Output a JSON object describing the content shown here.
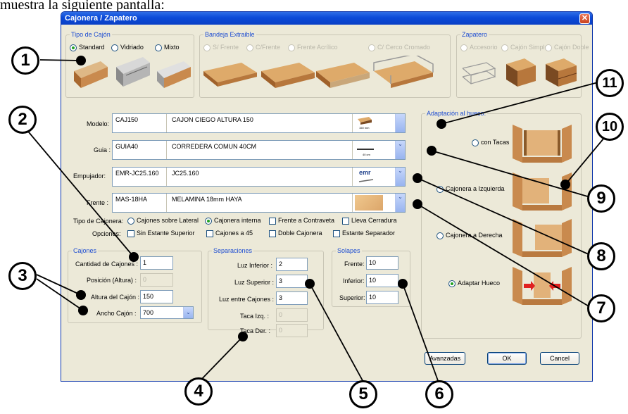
{
  "heading": "muestra la siguiente pantalla:",
  "window": {
    "title": "Cajonera / Zapatero",
    "close_glyph": "✕"
  },
  "tipo_cajon": {
    "legend": "Tipo de Cajón",
    "options": [
      {
        "label": "Standard",
        "selected": true
      },
      {
        "label": "Vidriado",
        "selected": false
      },
      {
        "label": "Mixto",
        "selected": false
      }
    ]
  },
  "bandeja": {
    "legend": "Bandeja Extraible",
    "options": [
      {
        "label": "S/ Frente"
      },
      {
        "label": "C/Frente"
      },
      {
        "label": "Frente Acrílico"
      },
      {
        "label": "C/ Cerco Cromado"
      }
    ]
  },
  "zapatero": {
    "legend": "Zapatero",
    "options": [
      {
        "label": "Accesorio"
      },
      {
        "label": "Cajón Simple"
      },
      {
        "label": "Cajón Doble"
      }
    ]
  },
  "combos": {
    "modelo": {
      "label": "Modelo:",
      "code": "CAJ150",
      "desc": "CAJON CIEGO ALTURA 150",
      "thumb_caption": "150 mm"
    },
    "guia": {
      "label": "Guia :",
      "code": "GUIA40",
      "desc": "CORREDERA COMUN 40CM",
      "thumb_caption": "40 cm"
    },
    "empujador": {
      "label": "Empujador:",
      "code": "EMR-JC25.160",
      "desc": "JC25.160",
      "thumb_caption": "emr"
    },
    "frente": {
      "label": "Frente :",
      "code": "MAS-18HA",
      "desc": "MELAMINA 18mm HAYA"
    }
  },
  "tipo_cajonera": {
    "label": "Tipo de Cajonera:",
    "options": [
      {
        "label": "Cajones sobre Lateral",
        "selected": false
      },
      {
        "label": "Cajonera interna",
        "selected": true
      }
    ],
    "checks": [
      {
        "label": "Frente a Contraveta"
      },
      {
        "label": "Lleva Cerradura"
      }
    ]
  },
  "opciones": {
    "label": "Opciones:",
    "checks": [
      {
        "label": "Sin Estante Superior"
      },
      {
        "label": "Cajones a 45"
      },
      {
        "label": "Doble Cajonera"
      },
      {
        "label": "Estante Separador"
      }
    ]
  },
  "cajones": {
    "legend": "Cajones",
    "cantidad_label": "Cantidad de Cajones :",
    "cantidad": "1",
    "posicion_label": "Posición (Altura) :",
    "posicion": "0",
    "altura_label": "Altura del Cajón :",
    "altura": "150",
    "ancho_label": "Ancho Cajón :",
    "ancho": "700"
  },
  "separaciones": {
    "legend": "Separaciones",
    "luz_inferior_label": "Luz Inferior :",
    "luz_inferior": "2",
    "luz_superior_label": "Luz Superior :",
    "luz_superior": "3",
    "luz_entre_label": "Luz entre Cajones :",
    "luz_entre": "3",
    "taca_izq_label": "Taca Izq. :",
    "taca_izq": "0",
    "taca_der_label": "Taca Der. :",
    "taca_der": "0"
  },
  "solapes": {
    "legend": "Solapes",
    "frente_label": "Frente:",
    "frente": "10",
    "inferior_label": "Inferior:",
    "inferior": "10",
    "superior_label": "Superior:",
    "superior": "10"
  },
  "adaptacion": {
    "legend": "Adaptación al hueco:",
    "options": [
      {
        "label": "con Tacas",
        "selected": false
      },
      {
        "label": "Cajonera a Izquierda",
        "selected": false
      },
      {
        "label": "Cajonera a Derecha",
        "selected": false
      },
      {
        "label": "Adaptar Hueco",
        "selected": true
      }
    ]
  },
  "buttons": {
    "avanzadas": "Avanzadas",
    "ok": "OK",
    "cancel": "Cancel"
  },
  "markers": [
    "1",
    "2",
    "3",
    "4",
    "5",
    "6",
    "7",
    "8",
    "9",
    "10",
    "11"
  ],
  "colors": {
    "title_bar": "#0b4ad8",
    "dialog_bg": "#ece9d8",
    "group_legend": "#1b4bd1",
    "wood": "#c98a4e",
    "arrow_red": "#e02020"
  }
}
